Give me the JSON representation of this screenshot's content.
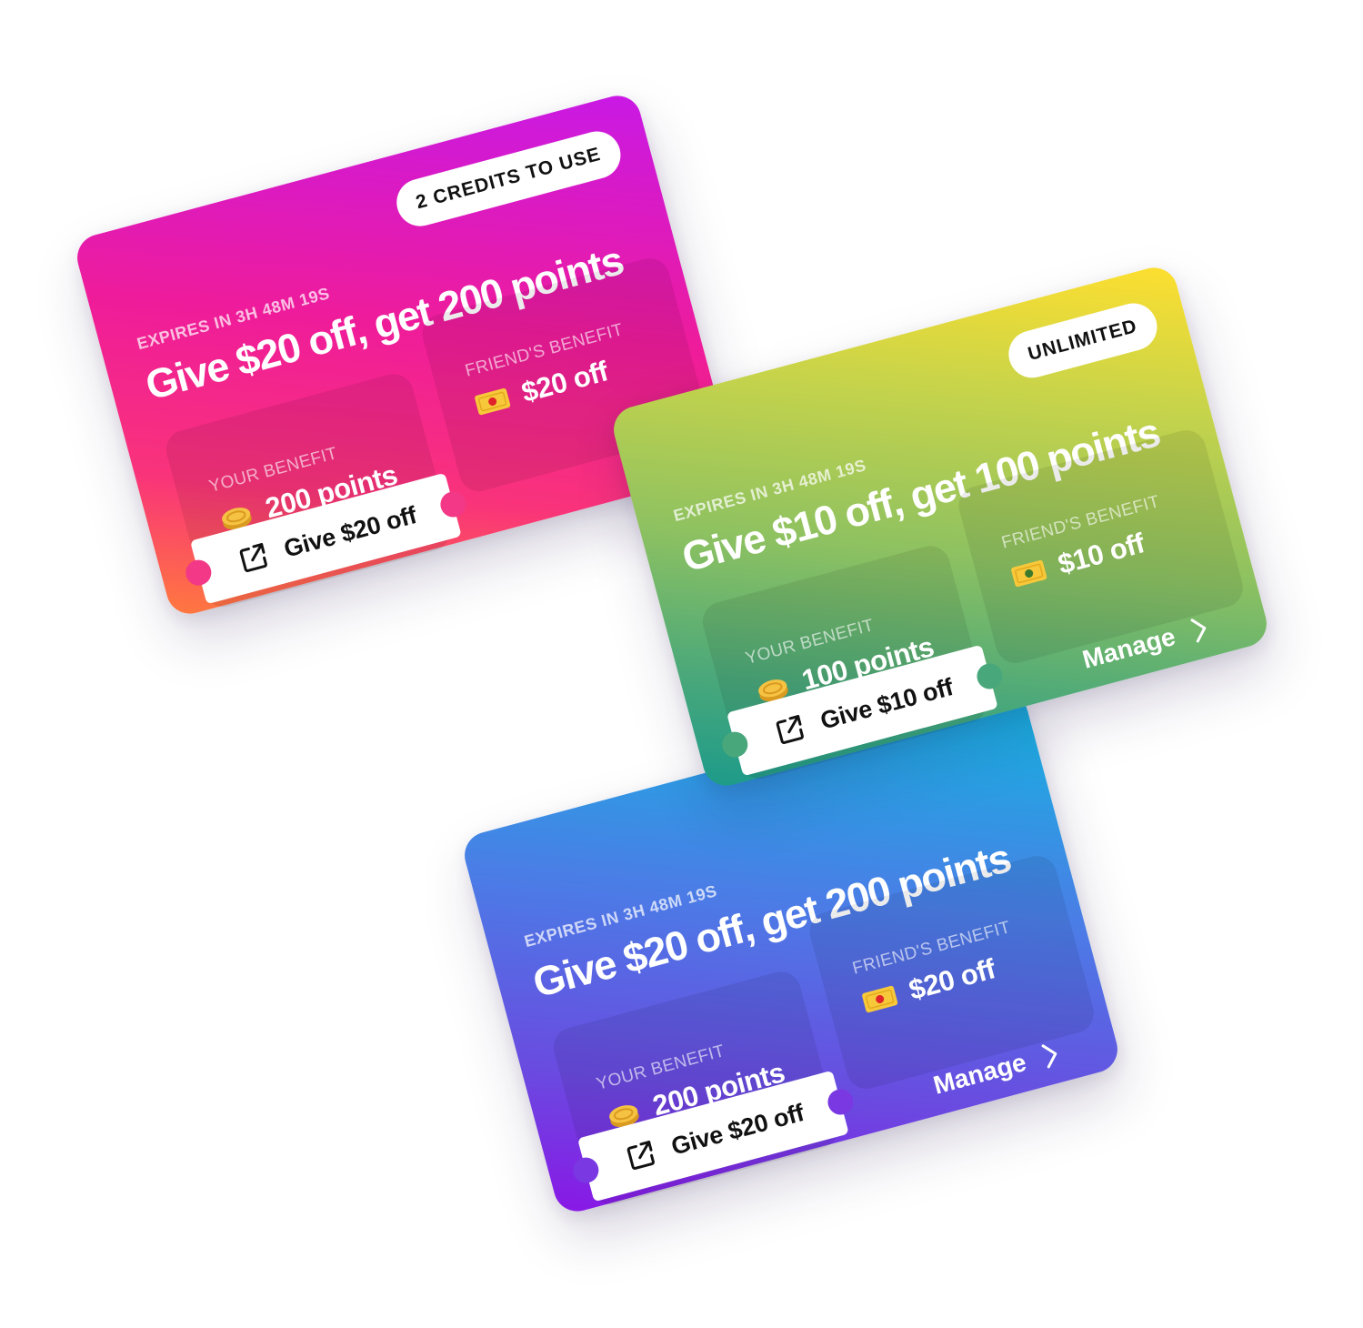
{
  "cards": {
    "pink": {
      "badge": "2 CREDITS TO USE",
      "expires": "EXPIRES IN 3H 48M 19S",
      "headline": "Give $20 off, get 200 points",
      "your_benefit_label": "YOUR BENEFIT",
      "your_benefit_value": "200 points",
      "friend_benefit_label": "FRIEND'S BENEFIT",
      "friend_benefit_value": "$20 off",
      "button_label": "Give $20 off",
      "your_icon": "coin-icon",
      "friend_icon": "cash-icon",
      "button_icon": "share-icon",
      "gradient": [
        "#c819e6",
        "#ef1c9a",
        "#ff7a3d"
      ]
    },
    "green": {
      "badge": "UNLIMITED",
      "expires": "EXPIRES IN 3H 48M 19S",
      "headline": "Give $10 off, get 100 points",
      "your_benefit_label": "YOUR BENEFIT",
      "your_benefit_value": "100 points",
      "friend_benefit_label": "FRIEND'S BENEFIT",
      "friend_benefit_value": "$10 off",
      "manage_label": "Manage",
      "button_label": "Give $10 off",
      "your_icon": "coin-icon",
      "friend_icon": "cash-icon",
      "button_icon": "share-icon",
      "manage_icon": "chevron-right-icon",
      "gradient": [
        "#ffdf2e",
        "#8dc161",
        "#1b9a8a"
      ]
    },
    "blue": {
      "expires": "EXPIRES IN 3H 48M 19S",
      "headline": "Give $20 off, get 200 points",
      "your_benefit_label": "YOUR BENEFIT",
      "your_benefit_value": "200 points",
      "friend_benefit_label": "FRIEND'S BENEFIT",
      "friend_benefit_value": "$20 off",
      "manage_label": "Manage",
      "button_label": "Give $20 off",
      "your_icon": "coin-icon",
      "friend_icon": "cash-icon",
      "button_icon": "share-icon",
      "manage_icon": "chevron-right-icon",
      "gradient": [
        "#12b7e0",
        "#6a4ae0",
        "#8a16e6"
      ]
    }
  },
  "colors": {
    "coin": "#f5c242",
    "coin_dark": "#d99a1f",
    "cash": "#f7c83a",
    "cash_dot": "#e0232a"
  }
}
